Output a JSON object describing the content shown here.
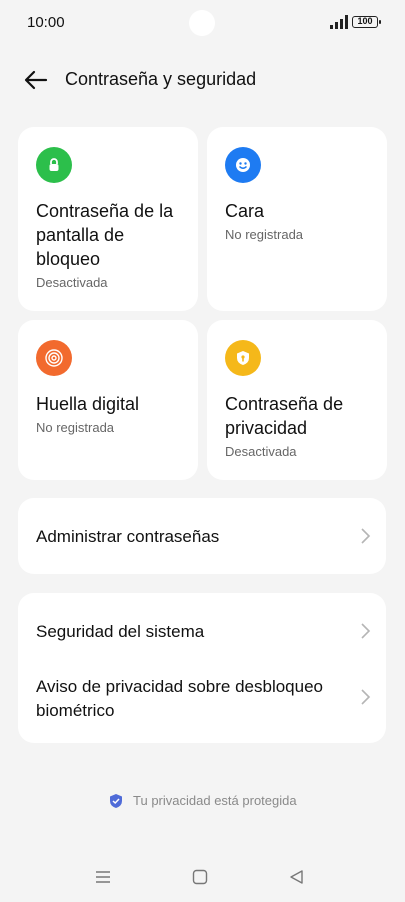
{
  "status_bar": {
    "time": "10:00",
    "battery": "100"
  },
  "header": {
    "title": "Contraseña y seguridad"
  },
  "tiles": [
    {
      "title": "Contraseña de la pantalla de bloqueo",
      "subtitle": "Desactivada",
      "icon": "lock-icon",
      "color": "#2cbf4b"
    },
    {
      "title": "Cara",
      "subtitle": "No registrada",
      "icon": "face-icon",
      "color": "#1e7bf2"
    },
    {
      "title": "Huella digital",
      "subtitle": "No registrada",
      "icon": "fingerprint-icon",
      "color": "#f26a2e"
    },
    {
      "title": "Contraseña de privacidad",
      "subtitle": "Desactivada",
      "icon": "privacy-shield-icon",
      "color": "#f5b81a"
    }
  ],
  "rows": {
    "manage_passwords": "Administrar contraseñas",
    "system_security": "Seguridad del sistema",
    "biometric_notice": "Aviso de privacidad sobre desbloqueo biométrico"
  },
  "footer": {
    "privacy_text": "Tu privacidad está protegida"
  },
  "nav": {
    "menu_icon": "menu-icon",
    "home_icon": "home-icon",
    "back_icon": "back-triangle-icon"
  }
}
